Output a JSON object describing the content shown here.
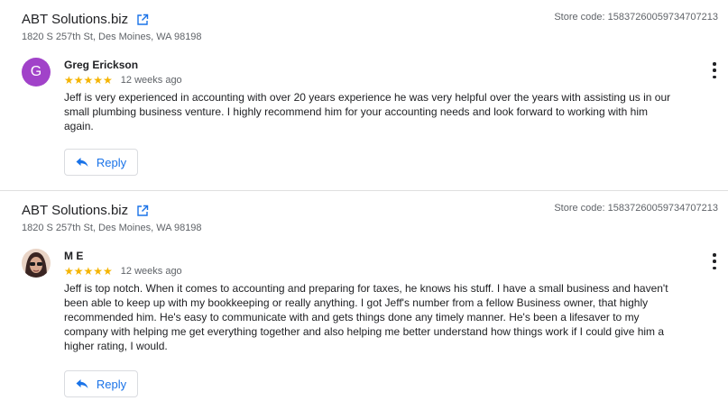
{
  "reviews": [
    {
      "business_name": "ABT Solutions.biz",
      "address": "1820 S 257th St, Des Moines, WA 98198",
      "store_code": "Store code: 15837260059734707213",
      "reviewer": "Greg Erickson",
      "avatar_letter": "G",
      "stars": "★★★★★",
      "rating": 5,
      "time_ago": "12 weeks ago",
      "text": "Jeff is very experienced in accounting with over 20 years experience he was very helpful over the years with assisting us in our small plumbing business venture. I highly recommend him for your accounting needs and look forward to working with him again.",
      "reply_label": "Reply"
    },
    {
      "business_name": "ABT Solutions.biz",
      "address": "1820 S 257th St, Des Moines, WA 98198",
      "store_code": "Store code: 15837260059734707213",
      "reviewer": "M E",
      "stars": "★★★★★",
      "rating": 5,
      "time_ago": "12 weeks ago",
      "text": "Jeff is top notch. When it comes to accounting and preparing for taxes, he knows his stuff. I have a small business and haven't been able to keep up with my bookkeeping or really anything. I got Jeff's number from a fellow Business owner, that highly recommended him. He's easy to communicate with and gets things done any timely manner. He's been a lifesaver to my company with helping me get everything together and also helping me better understand how things work if I could give him a higher rating, I would.",
      "reply_label": "Reply"
    }
  ],
  "colors": {
    "star": "#f5b400",
    "link": "#1a73e8",
    "avatar_g": "#a142c9"
  }
}
